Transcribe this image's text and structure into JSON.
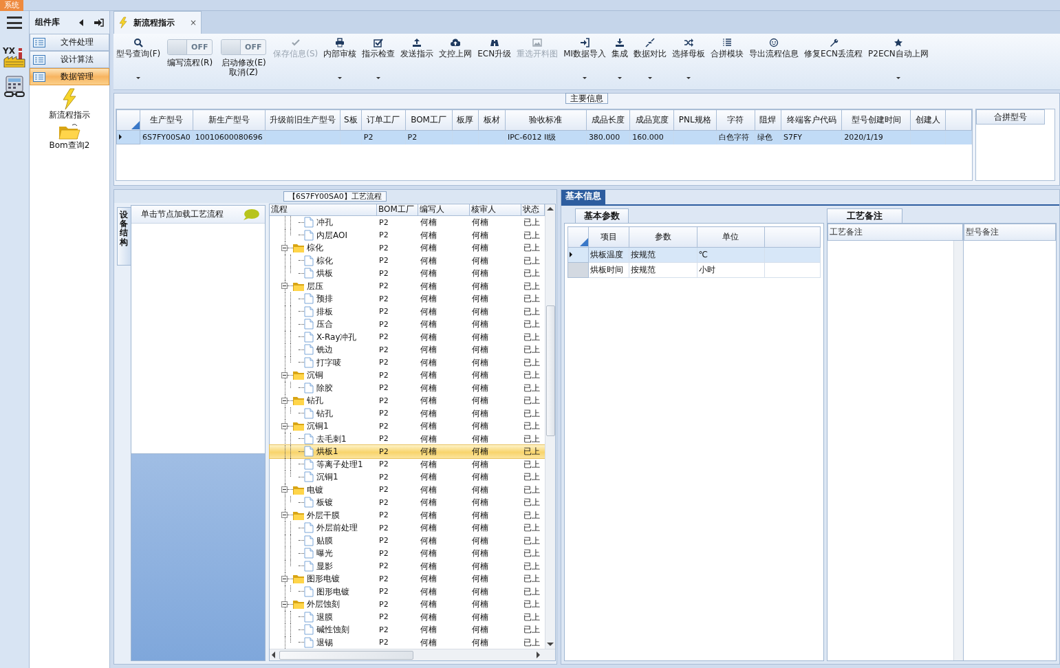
{
  "system_tab": "系统",
  "app_icons": [
    {
      "label": "YX"
    }
  ],
  "component_panel": {
    "title": "组件库",
    "nav": [
      {
        "label": "文件处理",
        "selected": false
      },
      {
        "label": "设计算法",
        "selected": false
      },
      {
        "label": "数据管理",
        "selected": true
      }
    ],
    "items": [
      {
        "label": "新流程指示"
      },
      {
        "label": "Bom查询2"
      }
    ]
  },
  "document_tab": {
    "title": "新流程指示",
    "close": "×",
    "selected": true
  },
  "toolbar": [
    {
      "kind": "button",
      "label": "型号查询(F)",
      "dropdown": true,
      "disabled": false
    },
    {
      "kind": "toggle",
      "switch_text": "OFF",
      "on": false,
      "label": "编写流程(R)"
    },
    {
      "kind": "toggle",
      "switch_text": "OFF",
      "on": false,
      "label": "启动修改(E)",
      "label2": "取消(Z)"
    },
    {
      "kind": "button",
      "label": "保存信息(S)",
      "dropdown": false,
      "disabled": true
    },
    {
      "kind": "button",
      "label": "内部审核",
      "dropdown": true,
      "disabled": false
    },
    {
      "kind": "button",
      "label": "指示检查",
      "dropdown": true,
      "disabled": false
    },
    {
      "kind": "button",
      "label": "发送指示",
      "dropdown": false,
      "disabled": false
    },
    {
      "kind": "button",
      "label": "文控上网",
      "dropdown": false,
      "disabled": false
    },
    {
      "kind": "button",
      "label": "ECN升级",
      "dropdown": false,
      "disabled": false
    },
    {
      "kind": "button",
      "label": "重选开料图",
      "dropdown": false,
      "disabled": true
    },
    {
      "kind": "button",
      "label": "MI数据导入",
      "dropdown": true,
      "disabled": false
    },
    {
      "kind": "button",
      "label": "集成",
      "dropdown": true,
      "disabled": false
    },
    {
      "kind": "button",
      "label": "数据对比",
      "dropdown": true,
      "disabled": false
    },
    {
      "kind": "button",
      "label": "选择母板",
      "dropdown": true,
      "disabled": false
    },
    {
      "kind": "button",
      "label": "合拼模块",
      "dropdown": false,
      "disabled": false
    },
    {
      "kind": "button",
      "label": "导出流程信息",
      "dropdown": false,
      "disabled": false
    },
    {
      "kind": "button",
      "label": "修复ECN丢流程",
      "dropdown": false,
      "disabled": false
    },
    {
      "kind": "button",
      "label": "P2ECN自动上网",
      "dropdown": true,
      "disabled": false
    }
  ],
  "main_info": {
    "title": "主要信息",
    "columns": [
      "生产型号",
      "新生产型号",
      "升级前旧生产型号",
      "S板",
      "订单工厂",
      "BOM工厂",
      "板厚",
      "板材",
      "验收标准",
      "成品长度",
      "成品宽度",
      "PNL规格",
      "字符",
      "阻焊",
      "终端客户代码",
      "型号创建时间",
      "创建人"
    ],
    "rows": [
      {
        "selected": true,
        "cells": [
          "6S7FY00SA0",
          "10010600080696",
          null,
          null,
          "P2",
          "P2",
          null,
          null,
          "IPC-6012 II级",
          "380.000",
          "160.000",
          null,
          "白色字符",
          "绿色",
          "S7FY",
          "2020/1/19",
          null
        ]
      }
    ],
    "side_column": "合拼型号"
  },
  "process_panel": {
    "title": "【6S7FY00SA0】工艺流程",
    "side_tab": "设备结构",
    "hint": "单击节点加载工艺流程"
  },
  "tree": {
    "columns": [
      "流程",
      "BOM工厂",
      "编写人",
      "核审人",
      "状态"
    ],
    "lead_rows": [
      {
        "cells": [
          "冲孔",
          "P2",
          "何楠",
          "何楠",
          "已上"
        ],
        "selected": false
      },
      {
        "cells": [
          "内层AOI",
          "P2",
          "何楠",
          "何楠",
          "已上"
        ],
        "selected": false
      }
    ],
    "rows": [
      {
        "cells": [
          "棕化",
          "P2",
          "何楠",
          "何楠",
          "已上"
        ],
        "selected": false,
        "expanded": true,
        "children": [
          {
            "cells": [
              "棕化",
              "P2",
              "何楠",
              "何楠",
              "已上"
            ],
            "selected": false
          },
          {
            "cells": [
              "烘板",
              "P2",
              "何楠",
              "何楠",
              "已上"
            ],
            "selected": false
          }
        ]
      },
      {
        "cells": [
          "层压",
          "P2",
          "何楠",
          "何楠",
          "已上"
        ],
        "selected": false,
        "expanded": true,
        "children": [
          {
            "cells": [
              "预排",
              "P2",
              "何楠",
              "何楠",
              "已上"
            ],
            "selected": false
          },
          {
            "cells": [
              "排板",
              "P2",
              "何楠",
              "何楠",
              "已上"
            ],
            "selected": false
          },
          {
            "cells": [
              "压合",
              "P2",
              "何楠",
              "何楠",
              "已上"
            ],
            "selected": false
          },
          {
            "cells": [
              "X-Ray冲孔",
              "P2",
              "何楠",
              "何楠",
              "已上"
            ],
            "selected": false
          },
          {
            "cells": [
              "铣边",
              "P2",
              "何楠",
              "何楠",
              "已上"
            ],
            "selected": false
          },
          {
            "cells": [
              "打字唛",
              "P2",
              "何楠",
              "何楠",
              "已上"
            ],
            "selected": false
          }
        ]
      },
      {
        "cells": [
          "沉铜",
          "P2",
          "何楠",
          "何楠",
          "已上"
        ],
        "selected": false,
        "expanded": true,
        "children": [
          {
            "cells": [
              "除胶",
              "P2",
              "何楠",
              "何楠",
              "已上"
            ],
            "selected": false
          }
        ]
      },
      {
        "cells": [
          "钻孔",
          "P2",
          "何楠",
          "何楠",
          "已上"
        ],
        "selected": false,
        "expanded": true,
        "children": [
          {
            "cells": [
              "钻孔",
              "P2",
              "何楠",
              "何楠",
              "已上"
            ],
            "selected": false
          }
        ]
      },
      {
        "cells": [
          "沉铜1",
          "P2",
          "何楠",
          "何楠",
          "已上"
        ],
        "selected": false,
        "expanded": true,
        "children": [
          {
            "cells": [
              "去毛刺1",
              "P2",
              "何楠",
              "何楠",
              "已上"
            ],
            "selected": false
          },
          {
            "cells": [
              "烘板1",
              "P2",
              "何楠",
              "何楠",
              "已上"
            ],
            "selected": true
          },
          {
            "cells": [
              "等离子处理1",
              "P2",
              "何楠",
              "何楠",
              "已上"
            ],
            "selected": false
          },
          {
            "cells": [
              "沉铜1",
              "P2",
              "何楠",
              "何楠",
              "已上"
            ],
            "selected": false
          }
        ]
      },
      {
        "cells": [
          "电镀",
          "P2",
          "何楠",
          "何楠",
          "已上"
        ],
        "selected": false,
        "expanded": true,
        "children": [
          {
            "cells": [
              "板镀",
              "P2",
              "何楠",
              "何楠",
              "已上"
            ],
            "selected": false
          }
        ]
      },
      {
        "cells": [
          "外层干膜",
          "P2",
          "何楠",
          "何楠",
          "已上"
        ],
        "selected": false,
        "expanded": true,
        "children": [
          {
            "cells": [
              "外层前处理",
              "P2",
              "何楠",
              "何楠",
              "已上"
            ],
            "selected": false
          },
          {
            "cells": [
              "贴膜",
              "P2",
              "何楠",
              "何楠",
              "已上"
            ],
            "selected": false
          },
          {
            "cells": [
              "曝光",
              "P2",
              "何楠",
              "何楠",
              "已上"
            ],
            "selected": false
          },
          {
            "cells": [
              "显影",
              "P2",
              "何楠",
              "何楠",
              "已上"
            ],
            "selected": false
          }
        ]
      },
      {
        "cells": [
          "图形电镀",
          "P2",
          "何楠",
          "何楠",
          "已上"
        ],
        "selected": false,
        "expanded": true,
        "children": [
          {
            "cells": [
              "图形电镀",
              "P2",
              "何楠",
              "何楠",
              "已上"
            ],
            "selected": false
          }
        ]
      },
      {
        "cells": [
          "外层蚀刻",
          "P2",
          "何楠",
          "何楠",
          "已上"
        ],
        "selected": false,
        "expanded": true,
        "children": [
          {
            "cells": [
              "退膜",
              "P2",
              "何楠",
              "何楠",
              "已上"
            ],
            "selected": false
          },
          {
            "cells": [
              "碱性蚀刻",
              "P2",
              "何楠",
              "何楠",
              "已上"
            ],
            "selected": false
          },
          {
            "cells": [
              "退锡",
              "P2",
              "何楠",
              "何楠",
              "已上"
            ],
            "selected": false
          }
        ]
      }
    ]
  },
  "detail": {
    "tab": "基本信息",
    "params_tab": "基本参数",
    "params_columns": [
      "项目",
      "参数",
      "单位"
    ],
    "params_rows": [
      {
        "cells": [
          "烘板温度",
          "按规范",
          "℃"
        ],
        "selected": true
      },
      {
        "cells": [
          "烘板时间",
          "按规范",
          "小时"
        ],
        "selected": false
      }
    ],
    "notes_tab": "工艺备注",
    "notes_columns": [
      "工艺备注",
      "型号备注"
    ]
  }
}
